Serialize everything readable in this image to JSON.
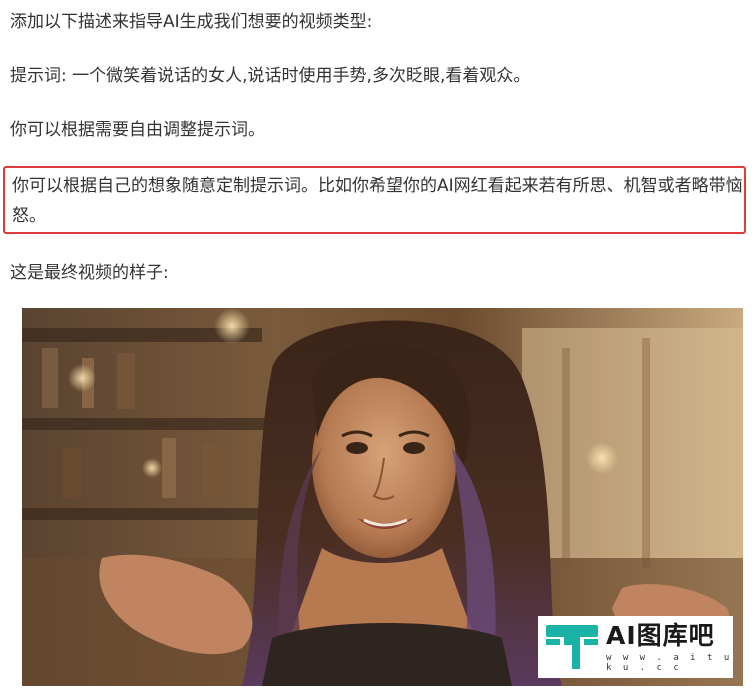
{
  "article": {
    "paragraphs": [
      "添加以下描述来指导AI生成我们想要的视频类型:",
      "提示词: 一个微笑着说话的女人,说话时使用手势,多次眨眼,看着观众。",
      "你可以根据需要自由调整提示词。",
      "你可以根据自己的想象随意定制提示词。比如你希望你的AI网红看起来若有所思、机智或者略带恼怒。",
      "这是最终视频的样子:"
    ]
  },
  "image": {
    "description_icon": "video-frame-smiling-woman"
  },
  "watermark": {
    "brand": "AI图库吧",
    "url": "w w w . a i t u k u . c c",
    "logo_color": "#1bb3a6"
  },
  "colors": {
    "highlight_border": "#e03b3b",
    "text": "#333333"
  }
}
